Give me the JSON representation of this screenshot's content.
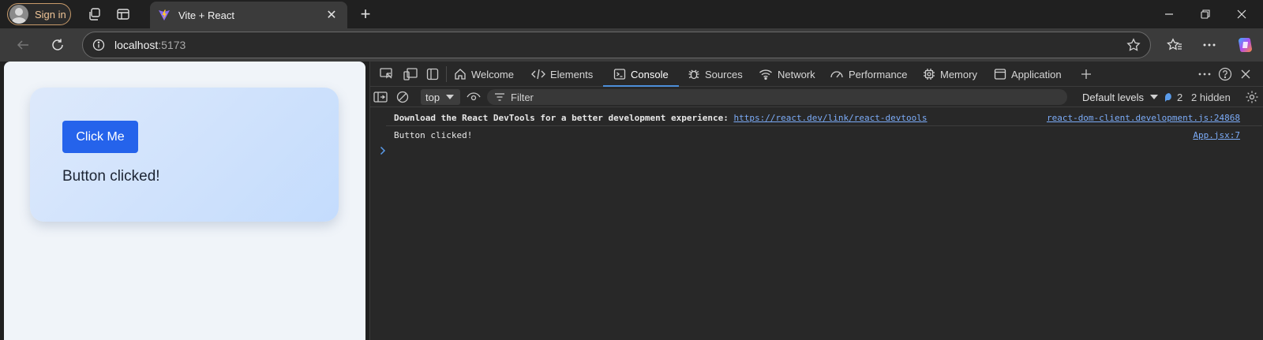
{
  "browser": {
    "signin_label": "Sign in",
    "tab": {
      "title": "Vite + React"
    },
    "address": {
      "host": "localhost",
      "port": ":5173"
    }
  },
  "page": {
    "button_label": "Click Me",
    "message": "Button clicked!"
  },
  "devtools": {
    "tabs": [
      {
        "label": "Welcome",
        "icon": "home-icon"
      },
      {
        "label": "Elements",
        "icon": "code-icon"
      },
      {
        "label": "Console",
        "icon": "console-icon",
        "active": true
      },
      {
        "label": "Sources",
        "icon": "bug-icon"
      },
      {
        "label": "Network",
        "icon": "wifi-icon"
      },
      {
        "label": "Performance",
        "icon": "gauge-icon"
      },
      {
        "label": "Memory",
        "icon": "chip-icon"
      },
      {
        "label": "Application",
        "icon": "window-icon"
      }
    ],
    "console_bar": {
      "context": "top",
      "filter_placeholder": "Filter",
      "levels": "Default levels",
      "issues_count": "2",
      "hidden": "2 hidden"
    },
    "logs": [
      {
        "text": "Download the React DevTools for a better development experience: ",
        "link": "https://react.dev/link/react-devtools",
        "source": "react-dom-client.development.js:24868"
      },
      {
        "text": "Button clicked!",
        "source": "App.jsx:7"
      }
    ]
  },
  "colors": {
    "accent_button": "#2563eb",
    "devtools_bg": "#282828",
    "link": "#7cacf8",
    "signin_border": "#c79a6a"
  }
}
